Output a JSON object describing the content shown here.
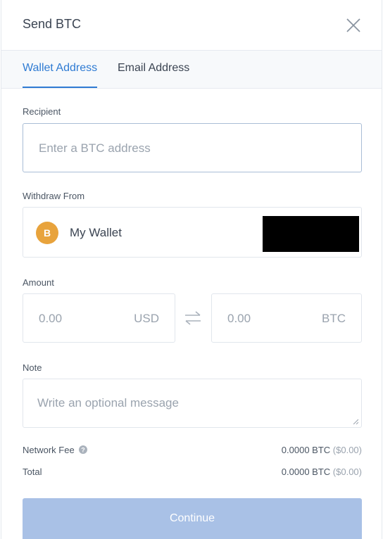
{
  "header": {
    "title": "Send BTC"
  },
  "tabs": [
    {
      "label": "Wallet Address",
      "active": true
    },
    {
      "label": "Email Address",
      "active": false
    }
  ],
  "recipient": {
    "label": "Recipient",
    "placeholder": "Enter a BTC address",
    "value": ""
  },
  "withdraw_from": {
    "label": "Withdraw From",
    "wallet_name": "My Wallet",
    "icon": "bitcoin-icon",
    "icon_letter": "B"
  },
  "amount": {
    "label": "Amount",
    "fiat_placeholder": "0.00",
    "fiat_currency": "USD",
    "crypto_placeholder": "0.00",
    "crypto_currency": "BTC"
  },
  "note": {
    "label": "Note",
    "placeholder": "Write an optional message"
  },
  "fees": {
    "network_fee_label": "Network Fee",
    "network_fee_crypto": "0.0000 BTC",
    "network_fee_fiat": "($0.00)",
    "total_label": "Total",
    "total_crypto": "0.0000 BTC",
    "total_fiat": "($0.00)"
  },
  "continue_label": "Continue",
  "colors": {
    "accent": "#2f7bd3",
    "button_disabled": "#a9c1e6",
    "bitcoin": "#e8a33c"
  }
}
